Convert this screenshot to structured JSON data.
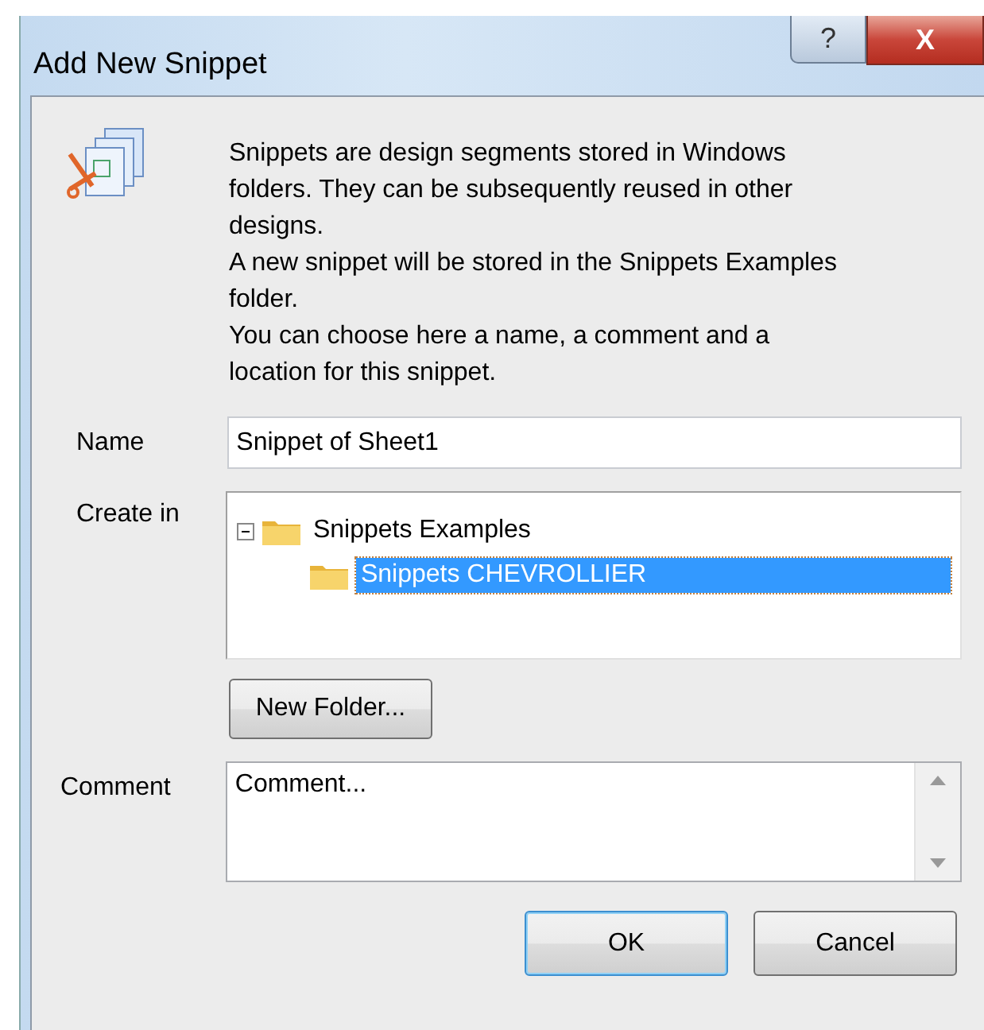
{
  "window": {
    "title": "Add New Snippet",
    "buttons": [
      "?",
      "X"
    ]
  },
  "description": "Snippets are design segments stored in Windows folders. They can be subsequently reused in other designs.\nA new snippet will be stored in the Snippets Examples folder.\nYou can choose here a name, a comment and a location for this snippet.",
  "name": {
    "label": "Name",
    "value": "Snippet of Sheet1"
  },
  "create_in": {
    "label": "Create in",
    "tree": [
      {
        "label": "Snippets Examples",
        "expanded": true,
        "selected": false,
        "children": [
          {
            "label": "Snippets CHEVROLLIER",
            "selected": true
          }
        ]
      }
    ]
  },
  "new_folder_button": "New Folder...",
  "comment": {
    "label": "Comment",
    "value": "Comment..."
  },
  "buttons": [
    {
      "label": "OK",
      "default": true
    },
    {
      "label": "Cancel",
      "default": false
    }
  ]
}
